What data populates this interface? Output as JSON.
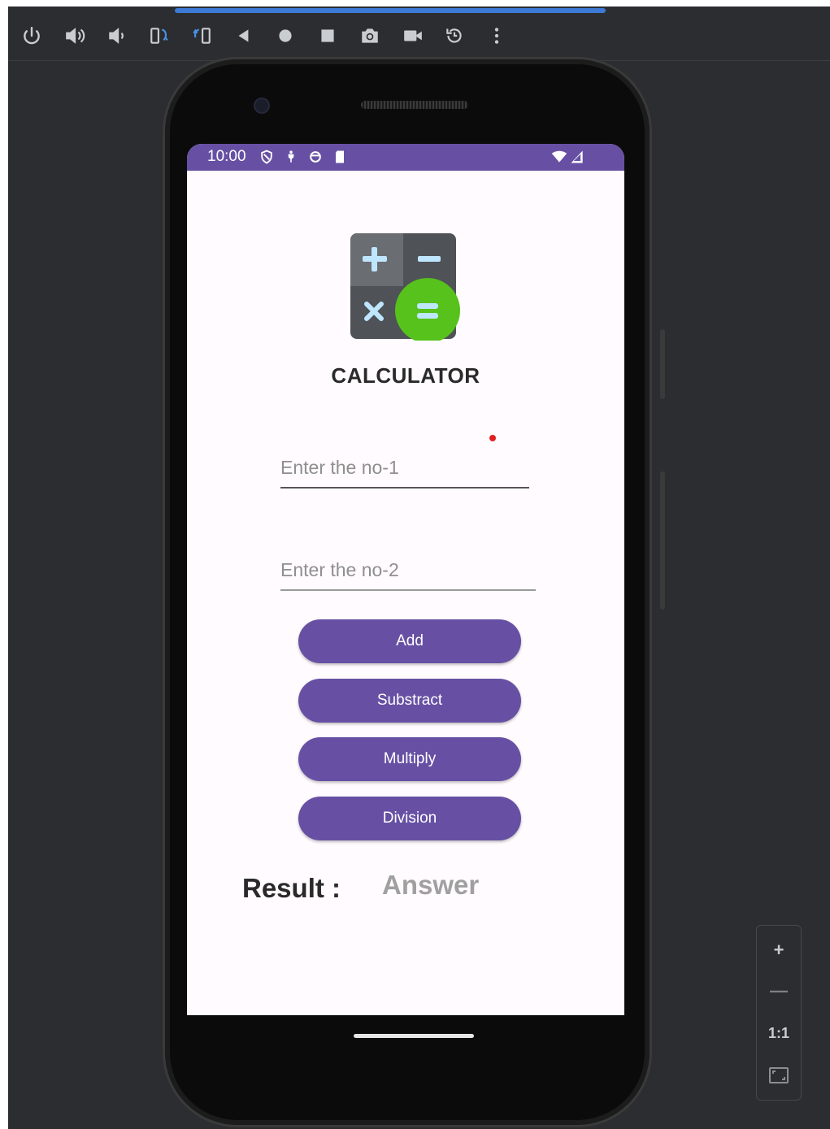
{
  "toolbar": {
    "icons": [
      "power-icon",
      "volume-up-icon",
      "volume-down-icon",
      "rotate-left-icon",
      "rotate-right-icon",
      "back-icon",
      "home-icon",
      "overview-icon",
      "screenshot-icon",
      "screen-record-icon",
      "snapshot-restore-icon",
      "more-icon"
    ]
  },
  "status_bar": {
    "time": "10:00",
    "color": "#6750a4"
  },
  "app": {
    "title": "CALCULATOR",
    "input1_placeholder": "Enter the no-1",
    "input2_placeholder": "Enter the no-2",
    "buttons": {
      "add": "Add",
      "subtract": "Substract",
      "multiply": "Multiply",
      "division": "Division"
    },
    "result_label": "Result :",
    "result_value": "Answer",
    "accent_color": "#6750a4"
  },
  "zoom_panel": {
    "zoom_in": "+",
    "zoom_out": "—",
    "actual_size": "1:1"
  }
}
